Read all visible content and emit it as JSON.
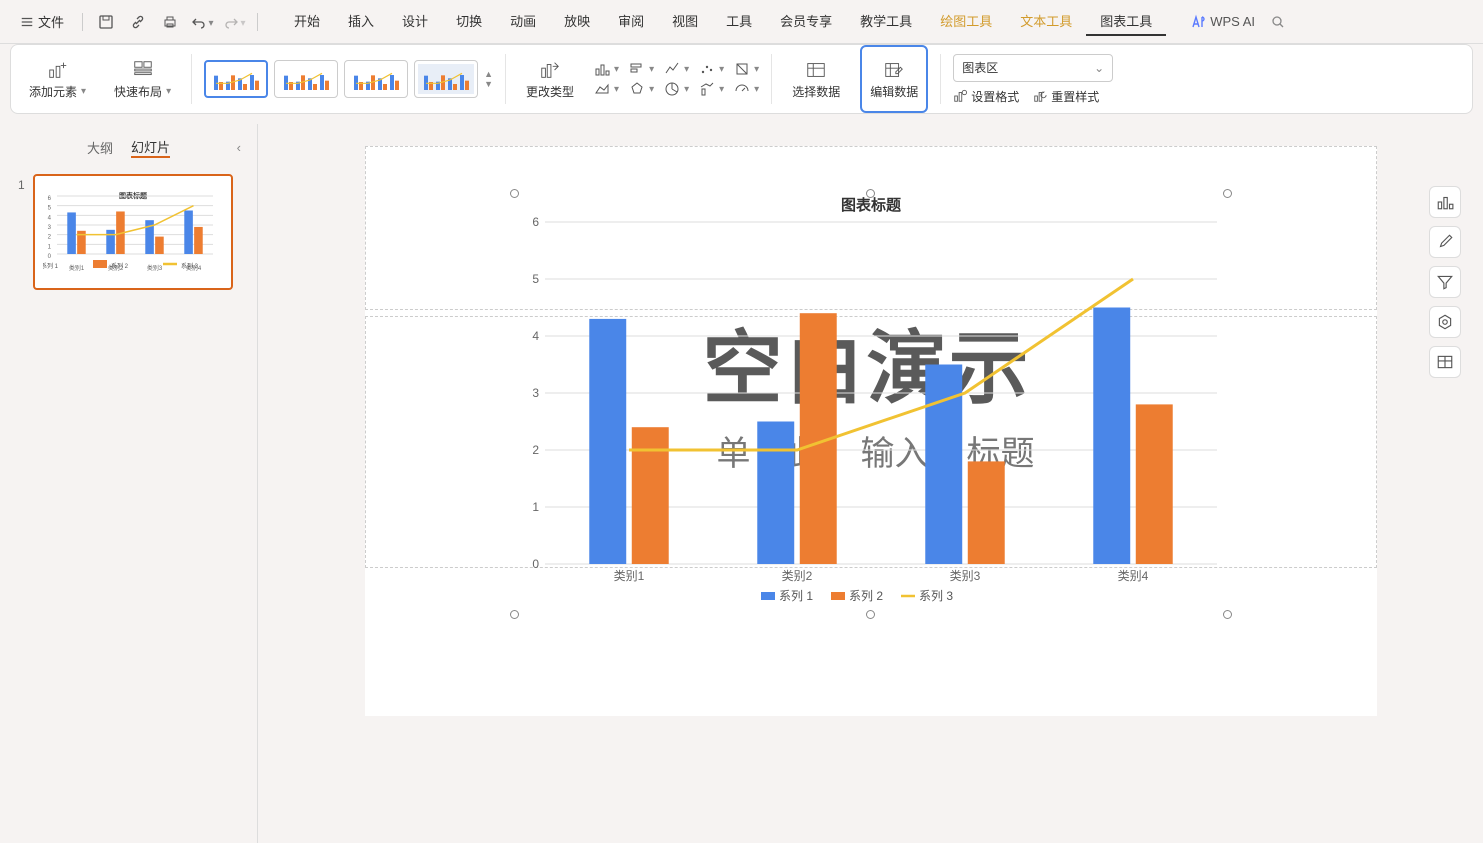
{
  "menubar": {
    "file": "文件",
    "tabs": [
      "开始",
      "插入",
      "设计",
      "切换",
      "动画",
      "放映",
      "审阅",
      "视图",
      "工具",
      "会员专享",
      "教学工具"
    ],
    "tool_tabs": [
      "绘图工具",
      "文本工具",
      "图表工具"
    ],
    "active_tool_tab": "图表工具",
    "wps_ai": "WPS AI"
  },
  "ribbon": {
    "add_element": "添加元素",
    "quick_layout": "快速布局",
    "change_type": "更改类型",
    "select_data": "选择数据",
    "edit_data": "编辑数据",
    "selector_value": "图表区",
    "set_format": "设置格式",
    "reset_style": "重置样式"
  },
  "left_panel": {
    "tab_outline": "大纲",
    "tab_slides": "幻灯片",
    "slide_numbers": [
      "1"
    ]
  },
  "slide": {
    "watermark_big": "空白演示",
    "watermark_small_prefix": "单",
    "watermark_small_mid": "此",
    "watermark_small_mid2": "输入",
    "watermark_small_suffix": "标题"
  },
  "chart_data": {
    "type": "bar-line-combo",
    "title": "图表标题",
    "categories": [
      "类别1",
      "类别2",
      "类别3",
      "类别4"
    ],
    "series": [
      {
        "name": "系列 1",
        "type": "bar",
        "color": "#4a86e8",
        "values": [
          4.3,
          2.5,
          3.5,
          4.5
        ]
      },
      {
        "name": "系列 2",
        "type": "bar",
        "color": "#ed7d31",
        "values": [
          2.4,
          4.4,
          1.8,
          2.8
        ]
      },
      {
        "name": "系列 3",
        "type": "line",
        "color": "#f1c232",
        "values": [
          2.0,
          2.0,
          3.0,
          5.0
        ]
      }
    ],
    "ylabel": "",
    "xlabel": "",
    "ylim": [
      0,
      6
    ],
    "yticks": [
      0,
      1,
      2,
      3,
      4,
      5,
      6
    ]
  }
}
